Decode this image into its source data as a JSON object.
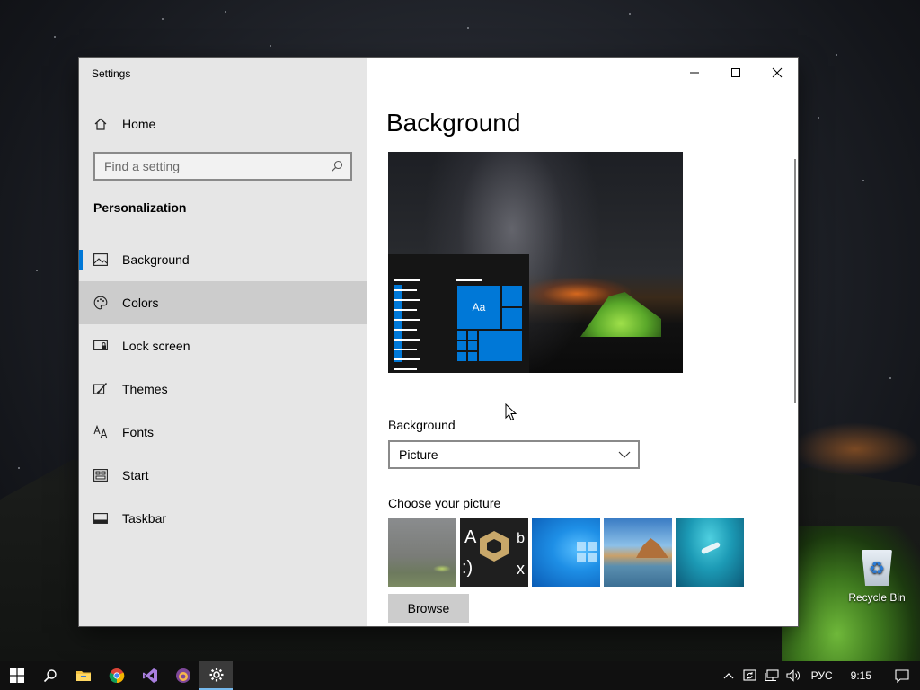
{
  "window": {
    "title": "Settings"
  },
  "sidebar": {
    "home_label": "Home",
    "search_placeholder": "Find a setting",
    "section_title": "Personalization",
    "items": [
      {
        "label": "Background",
        "icon": "picture-icon",
        "selected": true
      },
      {
        "label": "Colors",
        "icon": "palette-icon",
        "hovered": true
      },
      {
        "label": "Lock screen",
        "icon": "lock-screen-icon"
      },
      {
        "label": "Themes",
        "icon": "themes-brush-icon"
      },
      {
        "label": "Fonts",
        "icon": "fonts-icon"
      },
      {
        "label": "Start",
        "icon": "start-icon"
      },
      {
        "label": "Taskbar",
        "icon": "taskbar-icon"
      }
    ]
  },
  "main": {
    "page_title": "Background",
    "preview": {
      "tile_label": "Aa"
    },
    "background_label": "Background",
    "background_value": "Picture",
    "choose_label": "Choose your picture",
    "thumb2_text": {
      "a": "A",
      "smile": ":)",
      "b": "b",
      "x": "x"
    },
    "browse_label": "Browse"
  },
  "desktop": {
    "recycle_bin_label": "Recycle Bin"
  },
  "taskbar": {
    "language": "РУС",
    "time": "9:15"
  },
  "colors": {
    "accent": "#0078d7",
    "sidebar_bg": "#e6e6e6",
    "hover_bg": "#cccccc",
    "taskbar_bg": "#101010"
  }
}
